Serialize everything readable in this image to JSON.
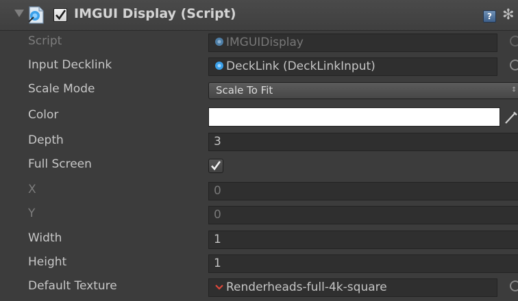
{
  "component": {
    "title": "IMGUI Display (Script)",
    "enabled": true,
    "help_icon": "help-book-icon",
    "settings_icon": "gear-icon",
    "help_glyph": "?",
    "gear_glyph": "✻"
  },
  "fields": {
    "script": {
      "label": "Script",
      "value": "IMGUIDisplay"
    },
    "input_decklink": {
      "label": "Input Decklink",
      "value": "DeckLink (DeckLinkInput)"
    },
    "scale_mode": {
      "label": "Scale Mode",
      "value": "Scale To Fit",
      "arrows": "⇕"
    },
    "color": {
      "label": "Color",
      "value": "#FFFFFF"
    },
    "depth": {
      "label": "Depth",
      "value": "3"
    },
    "full_screen": {
      "label": "Full Screen",
      "checked": true
    },
    "x": {
      "label": "X",
      "value": "0"
    },
    "y": {
      "label": "Y",
      "value": "0"
    },
    "width": {
      "label": "Width",
      "value": "1"
    },
    "height": {
      "label": "Height",
      "value": "1"
    },
    "default_texture": {
      "label": "Default Texture",
      "value": "Renderheads-full-4k-square"
    }
  },
  "colors": {
    "background": "#3c3c3c",
    "field_bg": "#2f2f2f",
    "text": "#c8c8c8",
    "dim_text": "#7d7d7d",
    "script_icon": "#4aa3e8",
    "texture_icon": "#e0473a"
  }
}
